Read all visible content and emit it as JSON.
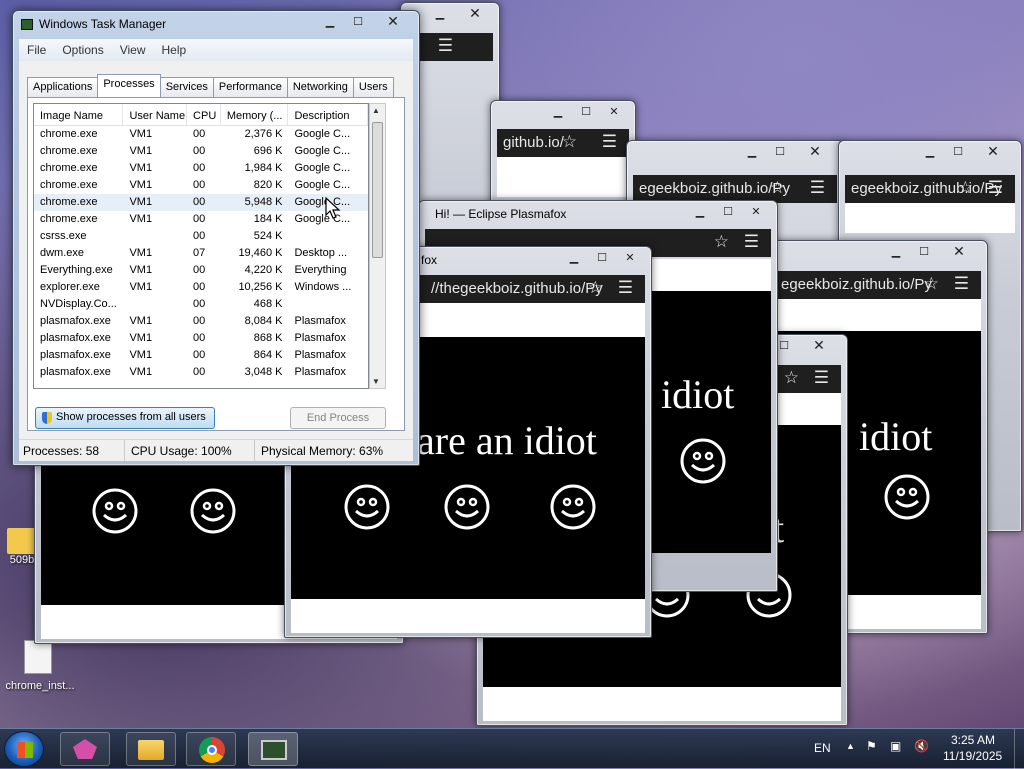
{
  "popup_windows": {
    "title": "Hi! — Eclipse Plasmafox",
    "title_short": "fox",
    "url_fragment": "//thegeekboiz.github.io/Py",
    "url_fragment2": "thegeekboiz.github.io/Py",
    "url_fragment3": "egeekboiz.github.io/Py",
    "url_fragment4": "github.io/",
    "message_main": "are an idiot",
    "message_right": "idiot",
    "message_partial": "t"
  },
  "task_manager": {
    "title": "Windows Task Manager",
    "menu": [
      "File",
      "Options",
      "View",
      "Help"
    ],
    "tabs": [
      "Applications",
      "Processes",
      "Services",
      "Performance",
      "Networking",
      "Users"
    ],
    "active_tab": "Processes",
    "columns": [
      "Image Name",
      "User Name",
      "CPU",
      "Memory (...",
      "Description"
    ],
    "rows": [
      {
        "image": "chrome.exe",
        "user": "VM1",
        "cpu": "00",
        "mem": "2,376 K",
        "desc": "Google C..."
      },
      {
        "image": "chrome.exe",
        "user": "VM1",
        "cpu": "00",
        "mem": "696 K",
        "desc": "Google C..."
      },
      {
        "image": "chrome.exe",
        "user": "VM1",
        "cpu": "00",
        "mem": "1,984 K",
        "desc": "Google C..."
      },
      {
        "image": "chrome.exe",
        "user": "VM1",
        "cpu": "00",
        "mem": "820 K",
        "desc": "Google C..."
      },
      {
        "image": "chrome.exe",
        "user": "VM1",
        "cpu": "00",
        "mem": "5,948 K",
        "desc": "Google C..."
      },
      {
        "image": "chrome.exe",
        "user": "VM1",
        "cpu": "00",
        "mem": "184 K",
        "desc": "Google C..."
      },
      {
        "image": "csrss.exe",
        "user": "",
        "cpu": "00",
        "mem": "524 K",
        "desc": ""
      },
      {
        "image": "dwm.exe",
        "user": "VM1",
        "cpu": "07",
        "mem": "19,460 K",
        "desc": "Desktop ..."
      },
      {
        "image": "Everything.exe",
        "user": "VM1",
        "cpu": "00",
        "mem": "4,220 K",
        "desc": "Everything"
      },
      {
        "image": "explorer.exe",
        "user": "VM1",
        "cpu": "00",
        "mem": "10,256 K",
        "desc": "Windows ..."
      },
      {
        "image": "NVDisplay.Co...",
        "user": "",
        "cpu": "00",
        "mem": "468 K",
        "desc": ""
      },
      {
        "image": "plasmafox.exe",
        "user": "VM1",
        "cpu": "00",
        "mem": "8,084 K",
        "desc": "Plasmafox"
      },
      {
        "image": "plasmafox.exe",
        "user": "VM1",
        "cpu": "00",
        "mem": "868 K",
        "desc": "Plasmafox"
      },
      {
        "image": "plasmafox.exe",
        "user": "VM1",
        "cpu": "00",
        "mem": "864 K",
        "desc": "Plasmafox"
      },
      {
        "image": "plasmafox.exe",
        "user": "VM1",
        "cpu": "00",
        "mem": "3,048 K",
        "desc": "Plasmafox"
      }
    ],
    "show_all_button": "Show processes from all users",
    "end_process_button": "End Process",
    "status": {
      "processes": "Processes: 58",
      "cpu": "CPU Usage: 100%",
      "memory": "Physical Memory: 63%"
    }
  },
  "desktop_icons": [
    {
      "label": "509b",
      "icon": "folder-icon"
    },
    {
      "label": "chrome_inst...",
      "icon": "file-icon"
    }
  ],
  "taskbar": {
    "apps": [
      "start-orb",
      "plasmafox-icon",
      "explorer-icon",
      "chrome-icon",
      "task-manager-icon"
    ],
    "language": "EN",
    "time": "3:25 AM",
    "date": "11/19/2025"
  }
}
